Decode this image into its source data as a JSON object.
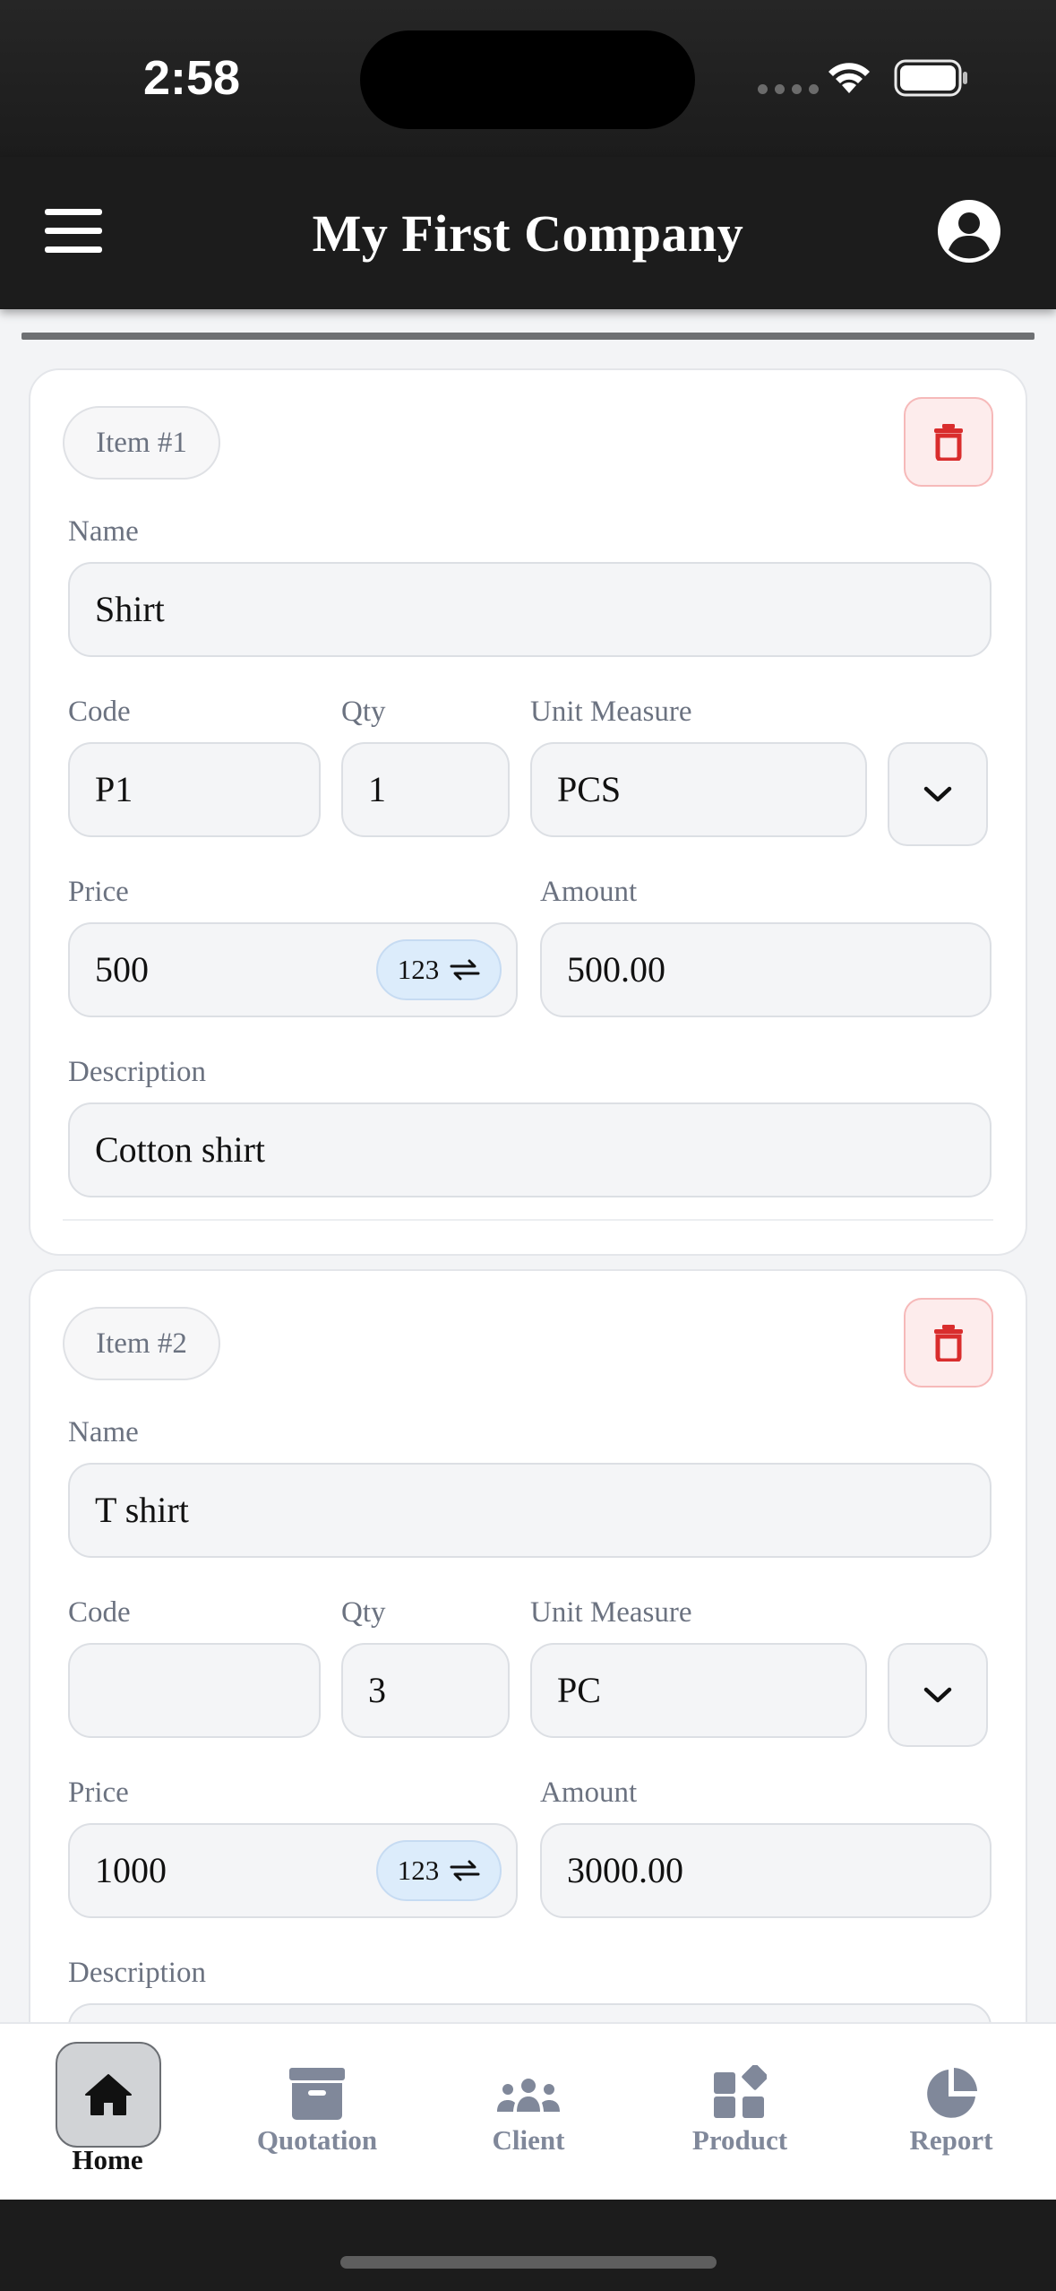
{
  "status_bar": {
    "time": "2:58"
  },
  "header": {
    "title": "My First Company"
  },
  "items": [
    {
      "badge": "Item #1",
      "name_label": "Name",
      "name": "Shirt",
      "code_label": "Code",
      "code": "P1",
      "qty_label": "Qty",
      "qty": "1",
      "unit_label": "Unit Measure",
      "unit": "PCS",
      "price_label": "Price",
      "price": "500",
      "keypad_label": "123",
      "amount_label": "Amount",
      "amount": "500.00",
      "description_label": "Description",
      "description": "Cotton shirt"
    },
    {
      "badge": "Item #2",
      "name_label": "Name",
      "name": "T shirt",
      "code_label": "Code",
      "code": "",
      "qty_label": "Qty",
      "qty": "3",
      "unit_label": "Unit Measure",
      "unit": "PC",
      "price_label": "Price",
      "price": "1000",
      "keypad_label": "123",
      "amount_label": "Amount",
      "amount": "3000.00",
      "description_label": "Description"
    }
  ],
  "tabs": [
    {
      "label": "Home",
      "icon": "home-icon",
      "active": true
    },
    {
      "label": "Quotation",
      "icon": "archive-icon"
    },
    {
      "label": "Client",
      "icon": "users-icon"
    },
    {
      "label": "Product",
      "icon": "shapes-icon"
    },
    {
      "label": "Report",
      "icon": "pie-chart-icon"
    }
  ],
  "colors": {
    "header_bg": "#1c1c1c",
    "delete_red": "#d92d2d",
    "tab_inactive": "#80889a",
    "keypad_badge_bg": "#dcecfb"
  }
}
